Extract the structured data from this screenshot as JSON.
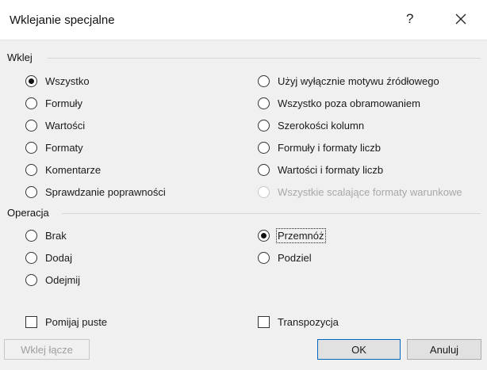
{
  "dialog": {
    "title": "Wklejanie specjalne",
    "help_glyph": "?"
  },
  "paste_group": {
    "label": "Wklej",
    "options_left": [
      {
        "label": "Wszystko",
        "checked": true
      },
      {
        "label": "Formuły",
        "checked": false
      },
      {
        "label": "Wartości",
        "checked": false
      },
      {
        "label": "Formaty",
        "checked": false
      },
      {
        "label": "Komentarze",
        "checked": false
      },
      {
        "label": "Sprawdzanie poprawności",
        "checked": false
      }
    ],
    "options_right": [
      {
        "label": "Użyj wyłącznie motywu źródłowego",
        "checked": false
      },
      {
        "label": "Wszystko poza obramowaniem",
        "checked": false
      },
      {
        "label": "Szerokości kolumn",
        "checked": false
      },
      {
        "label": "Formuły i formaty liczb",
        "checked": false
      },
      {
        "label": "Wartości i formaty liczb",
        "checked": false
      },
      {
        "label": "Wszystkie scalające formaty warunkowe",
        "checked": false,
        "disabled": true
      }
    ]
  },
  "operation_group": {
    "label": "Operacja",
    "options_left": [
      {
        "label": "Brak",
        "checked": false
      },
      {
        "label": "Dodaj",
        "checked": false
      },
      {
        "label": "Odejmij",
        "checked": false
      }
    ],
    "options_right": [
      {
        "label": "Przemnóż",
        "checked": true
      },
      {
        "label": "Podziel",
        "checked": false
      }
    ]
  },
  "checkboxes": {
    "skip_blanks": {
      "label": "Pomijaj puste",
      "checked": false
    },
    "transpose": {
      "label": "Transpozycja",
      "checked": false
    }
  },
  "buttons": {
    "paste_link": "Wklej łącze",
    "ok": "OK",
    "cancel": "Anuluj"
  }
}
